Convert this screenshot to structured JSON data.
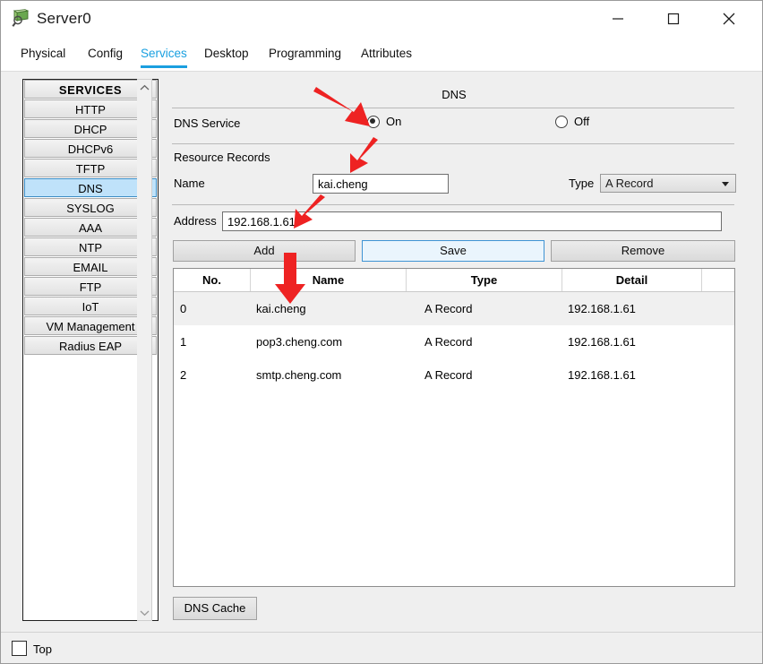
{
  "window": {
    "title": "Server0",
    "icon": "server-magnifier-icon",
    "minimize_label": "—",
    "maximize_label": "☐",
    "close_label": "✕"
  },
  "tabs": [
    {
      "label": "Physical",
      "active": false
    },
    {
      "label": "Config",
      "active": false
    },
    {
      "label": "Services",
      "active": true
    },
    {
      "label": "Desktop",
      "active": false
    },
    {
      "label": "Programming",
      "active": false
    },
    {
      "label": "Attributes",
      "active": false
    }
  ],
  "sidebar": {
    "header": "SERVICES",
    "items": [
      {
        "label": "HTTP",
        "selected": false
      },
      {
        "label": "DHCP",
        "selected": false
      },
      {
        "label": "DHCPv6",
        "selected": false
      },
      {
        "label": "TFTP",
        "selected": false
      },
      {
        "label": "DNS",
        "selected": true
      },
      {
        "label": "SYSLOG",
        "selected": false
      },
      {
        "label": "AAA",
        "selected": false
      },
      {
        "label": "NTP",
        "selected": false
      },
      {
        "label": "EMAIL",
        "selected": false
      },
      {
        "label": "FTP",
        "selected": false
      },
      {
        "label": "IoT",
        "selected": false
      },
      {
        "label": "VM Management",
        "selected": false
      },
      {
        "label": "Radius EAP",
        "selected": false
      }
    ],
    "scroll_up_icon": "chevron-up-icon",
    "scroll_down_icon": "chevron-down-icon"
  },
  "panel": {
    "title": "DNS",
    "service_label": "DNS Service",
    "radio_on_label": "On",
    "radio_off_label": "Off",
    "service_state": "On",
    "resource_records_label": "Resource Records",
    "name_label": "Name",
    "name_value": "kai.cheng",
    "type_label": "Type",
    "type_value": "A Record",
    "address_label": "Address",
    "address_value": "192.168.1.61",
    "buttons": {
      "add": "Add",
      "save": "Save",
      "remove": "Remove",
      "dns_cache": "DNS Cache"
    },
    "table": {
      "columns": [
        "No.",
        "Name",
        "Type",
        "Detail"
      ],
      "rows": [
        {
          "no": "0",
          "name": "kai.cheng",
          "type": "A Record",
          "detail": "192.168.1.61"
        },
        {
          "no": "1",
          "name": "pop3.cheng.com",
          "type": "A Record",
          "detail": "192.168.1.61"
        },
        {
          "no": "2",
          "name": "smtp.cheng.com",
          "type": "A Record",
          "detail": "192.168.1.61"
        }
      ]
    }
  },
  "footer": {
    "top_label": "Top",
    "top_checked": false
  },
  "colors": {
    "accent": "#1b9fe0",
    "selection": "#bfe2fa",
    "annotation_arrow": "#ee2222",
    "panel_bg": "#efefef"
  },
  "annotations": {
    "arrow_color": "#ee2222",
    "arrows": [
      {
        "name": "arrow-to-dns-on-radio",
        "target": "On radio button"
      },
      {
        "name": "arrow-to-name-input",
        "target": "Name input field"
      },
      {
        "name": "arrow-to-address-input",
        "target": "Address input field"
      },
      {
        "name": "arrow-to-first-record-row",
        "target": "Record row 0"
      }
    ]
  }
}
